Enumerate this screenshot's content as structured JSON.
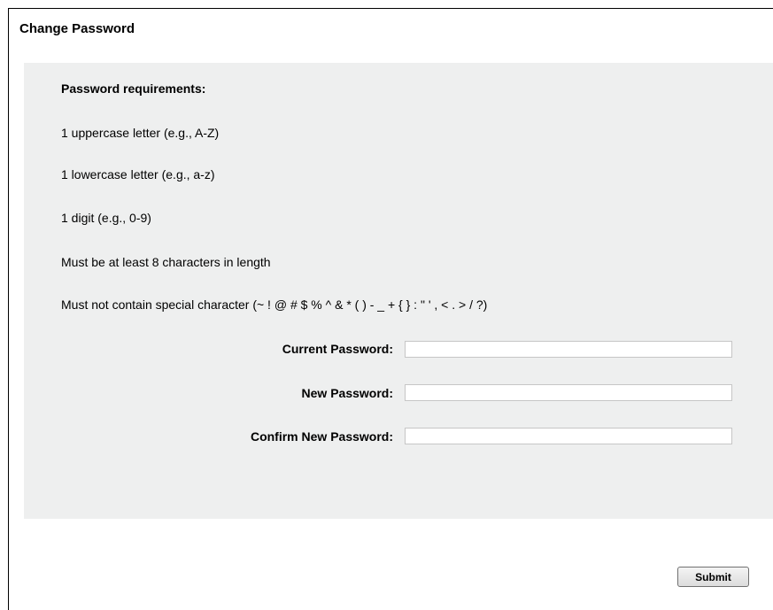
{
  "form": {
    "title": "Change Password",
    "requirements": {
      "heading": "Password requirements:",
      "items": [
        "1 uppercase letter (e.g., A-Z)",
        "1 lowercase letter (e.g., a-z)",
        "1 digit (e.g., 0-9)",
        "Must be at least 8 characters in length",
        "Must not contain special character (~ ! @ # $ % ^ & * ( ) - _ + { } : \" ' , < . > / ?)"
      ]
    },
    "fields": [
      {
        "label": "Current Password:",
        "value": ""
      },
      {
        "label": "New Password:",
        "value": ""
      },
      {
        "label": "Confirm New Password:",
        "value": ""
      }
    ],
    "submit_label": "Submit"
  },
  "colors": {
    "panel_background": "#eeefef",
    "input_border": "#c6c6c6"
  }
}
